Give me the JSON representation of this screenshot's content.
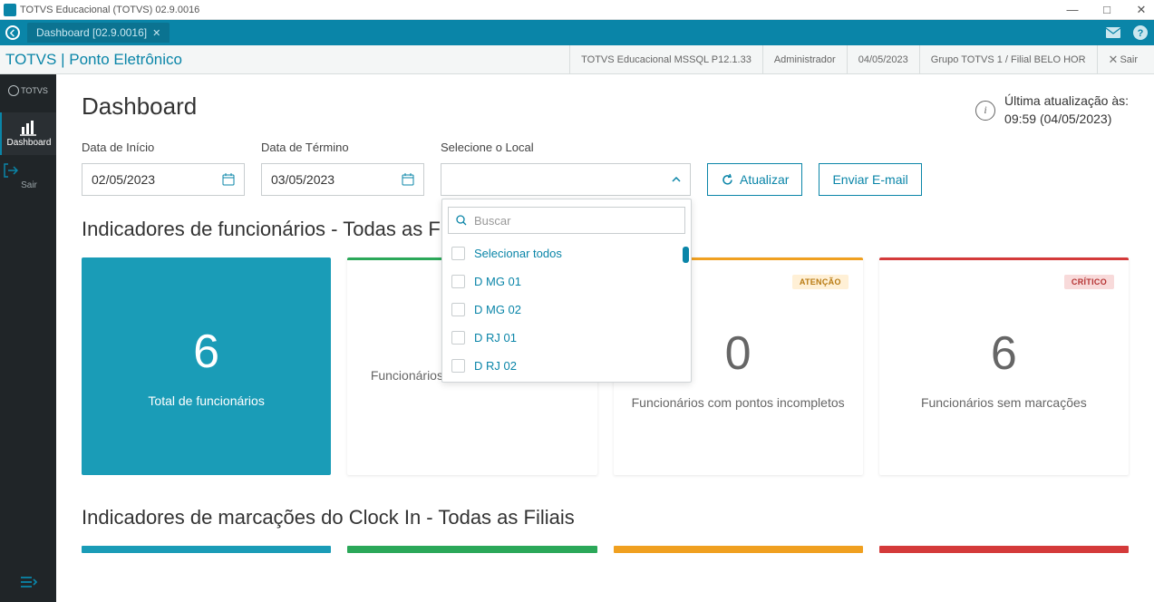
{
  "titlebar": {
    "text": "TOTVS Educacional (TOTVS) 02.9.0016"
  },
  "tab": {
    "label": "Dashboard [02.9.0016]"
  },
  "header": {
    "title": "TOTVS | Ponto Eletrônico",
    "env": "TOTVS Educacional MSSQL P12.1.33",
    "user": "Administrador",
    "date": "04/05/2023",
    "group": "Grupo TOTVS 1 / Filial BELO HOR",
    "exit": "Sair"
  },
  "sidebar": {
    "logo": "TOTVS",
    "items": [
      {
        "icon": "chart",
        "label": "Dashboard"
      },
      {
        "icon": "logout",
        "label": "Sair"
      }
    ]
  },
  "page": {
    "title": "Dashboard",
    "update_label": "Última atualização às:",
    "update_time": "09:59 (04/05/2023)"
  },
  "filters": {
    "start_label": "Data de Início",
    "start_value": "02/05/2023",
    "end_label": "Data de Término",
    "end_value": "03/05/2023",
    "local_label": "Selecione o Local",
    "refresh": "Atualizar",
    "email": "Enviar E-mail"
  },
  "dropdown": {
    "search_placeholder": "Buscar",
    "select_all": "Selecionar todos",
    "options": [
      "D MG 01",
      "D MG 02",
      "D RJ 01",
      "D RJ 02"
    ]
  },
  "section1": {
    "title": "Indicadores de funcionários - Todas as Filiais"
  },
  "cards": [
    {
      "num": "6",
      "label": "Total de funcionários",
      "kind": "primary"
    },
    {
      "num": "",
      "label": "Funcionários com pontos completos",
      "kind": "green"
    },
    {
      "num": "0",
      "label": "Funcionários com pontos incompletos",
      "kind": "orange",
      "badge": "ATENÇÃO"
    },
    {
      "num": "6",
      "label": "Funcionários sem marcações",
      "kind": "red",
      "badge": "CRÍTICO"
    }
  ],
  "section2": {
    "title": "Indicadores de marcações do Clock In - Todas as Filiais"
  }
}
